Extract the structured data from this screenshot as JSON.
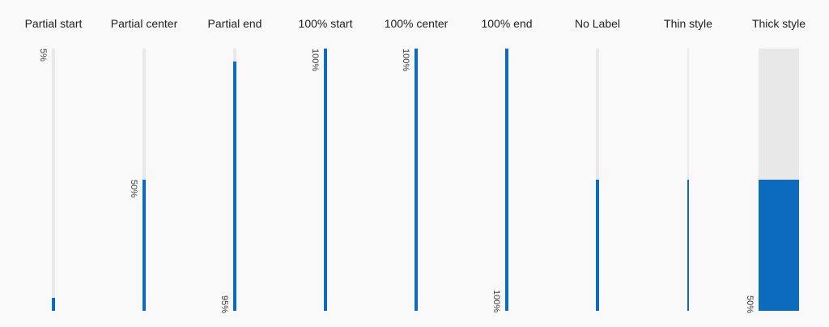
{
  "colors": {
    "background": "#f9f9f9",
    "track": "#e8e8e8",
    "fill": "#0d6bbd",
    "text": "#202124"
  },
  "bars": [
    {
      "title": "Partial start",
      "value": 5,
      "label": "5%",
      "label_position": "start",
      "style": "normal"
    },
    {
      "title": "Partial center",
      "value": 50,
      "label": "50%",
      "label_position": "center",
      "style": "normal"
    },
    {
      "title": "Partial end",
      "value": 95,
      "label": "95%",
      "label_position": "end",
      "style": "normal"
    },
    {
      "title": "100% start",
      "value": 100,
      "label": "100%",
      "label_position": "start",
      "style": "normal"
    },
    {
      "title": "100% center",
      "value": 100,
      "label": "100%",
      "label_position": "center",
      "style": "normal"
    },
    {
      "title": "100% end",
      "value": 100,
      "label": "100%",
      "label_position": "end",
      "style": "normal"
    },
    {
      "title": "No Label",
      "value": 50,
      "label": "",
      "label_position": "none",
      "style": "normal"
    },
    {
      "title": "Thin style",
      "value": 50,
      "label": "",
      "label_position": "none",
      "style": "thin"
    },
    {
      "title": "Thick style",
      "value": 50,
      "label": "50%",
      "label_position": "end",
      "style": "thick"
    }
  ]
}
